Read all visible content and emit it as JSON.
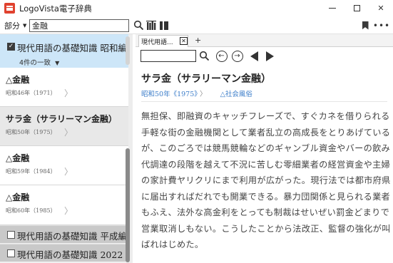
{
  "window": {
    "title": "LogoVista電子辞典",
    "minimize_label": "",
    "maximize_label": "",
    "close_label": "✕"
  },
  "toolbar": {
    "scope_label": "部分",
    "search_value": "金融",
    "search_placeholder": ""
  },
  "sidebar": {
    "active_dict": {
      "name": "現代用語の基礎知識 昭和編",
      "checked": true,
      "match_count": "4件の一致"
    },
    "results": [
      {
        "headword": "△金融",
        "era": "昭和46年（1971）"
      },
      {
        "headword": "サラ金（サラリーマン金融）",
        "era": "昭和50年（1975）"
      },
      {
        "headword": "△金融",
        "era": "昭和59年（1984）"
      },
      {
        "headword": "△金融",
        "era": "昭和60年（1985）"
      }
    ],
    "other_dicts": [
      {
        "name": "現代用語の基礎知識 平成編",
        "checked": false
      },
      {
        "name": "現代用語の基礎知識 2022",
        "checked": false
      }
    ]
  },
  "tabs": [
    {
      "label": "現代用語...",
      "close": "✕"
    }
  ],
  "new_tab_label": "+",
  "entry": {
    "title": "サラ金（サラリーマン金融）",
    "era": "昭和50年《1975》",
    "era_chevron": "〉",
    "category": "△社会風俗",
    "body": "無担保、即融資のキャッチフレーズで、すぐカネを借りられる手軽な街の金融機関として業者乱立の高成長をとりあげているが、このごろでは競馬競輪などのギャンブル資金やバーの飲み代調達の段階を越えて不況に苦しむ零細業者の経営資金や主婦の家計費ヤリクリにまで利用が広がった。現行法では都市府県に届出すればだれでも開業できる。暴力団関係と見られる業者もふえ、法外な高金利をとっても制裁はせいぜい罰金どまりで営業取消しもない。こうしたことから法改正、監督の強化が叫ばれはじめた。"
  },
  "colors": {
    "accent": "#e0422f",
    "selected_dict_bg": "#cde6f8",
    "link": "#3a7cc9"
  }
}
